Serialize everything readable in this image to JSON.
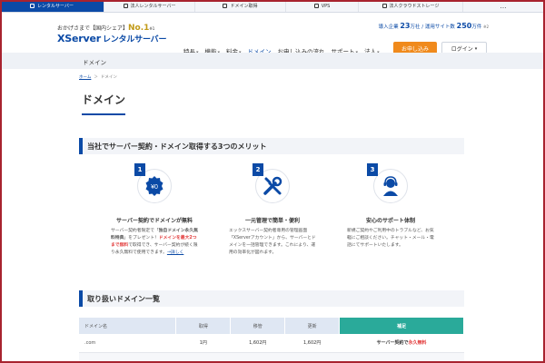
{
  "service_tabs": [
    {
      "label": "レンタルサーバー",
      "active": true
    },
    {
      "label": "法人レンタルサーバー",
      "active": false
    },
    {
      "label": "ドメイン取得",
      "active": false
    },
    {
      "label": "VPS",
      "active": false
    },
    {
      "label": "法人クラウドストレージ",
      "active": false
    },
    {
      "label": "…",
      "active": false
    }
  ],
  "header": {
    "tagline_pre": "おかげさまで【国内シェア】",
    "tagline_no1": "No.1",
    "tagline_note": "※1",
    "logo_main": "XServer",
    "logo_suffix": "レンタルサーバー",
    "stats_companies_label": "導入企業",
    "stats_companies_value": "23",
    "stats_companies_unit": "万社",
    "stats_sites_label": "/ 運用サイト数",
    "stats_sites_value": "250",
    "stats_sites_unit": "万件",
    "stats_note": "※2",
    "nav": [
      {
        "label": "特長",
        "chevron": true
      },
      {
        "label": "機能",
        "chevron": true
      },
      {
        "label": "料金",
        "chevron": true
      },
      {
        "label": "ドメイン",
        "chevron": false,
        "current": true
      },
      {
        "label": "お申し込みの流れ",
        "chevron": false
      },
      {
        "label": "サポート",
        "chevron": true
      },
      {
        "label": "法人",
        "chevron": true
      }
    ],
    "cta_label": "お申し込み",
    "login_label": "ログイン"
  },
  "category_label": "ドメイン",
  "breadcrumb": {
    "home": "ホーム",
    "sep": "＞",
    "current": "ドメイン"
  },
  "page_title": "ドメイン",
  "section1_title": "当社でサーバー契約・ドメイン取得する3つのメリット",
  "merits": [
    {
      "number": "1",
      "icon": "free-badge-icon",
      "title": "サーバー契約でドメインが無料",
      "desc_a": "サーバー契約者限定で「",
      "desc_b": "独自ドメイン永久無料特典",
      "desc_c": "」をプレゼント！",
      "desc_d": "ドメインを最大2つまで無料",
      "desc_e": "で取得でき、サーバー契約が続く限り永久無料で使用できます。",
      "link": "→詳しく"
    },
    {
      "number": "2",
      "icon": "tools-icon",
      "title": "一元管理で簡単・便利",
      "desc": "エックスサーバー契約者専用の管理画面「XServerアカウント」から、サーバーとドメインを一括管理できます。これにより、運用の効率化が図れます。"
    },
    {
      "number": "3",
      "icon": "support-operator-icon",
      "title": "安心のサポート体制",
      "desc": "新規ご契約やご利用中のトラブルなど、お気軽にご相談ください。チャット・メール・電話にてサポートいたします。"
    }
  ],
  "section2_title": "取り扱いドメイン一覧",
  "table": {
    "headers": [
      "ドメイン名",
      "取得",
      "移管",
      "更新",
      "補足"
    ],
    "rows": [
      {
        "domain": ".com",
        "acquire": "1円",
        "transfer": "1,602円",
        "renew": "1,602円",
        "note_a": "サーバー契約で",
        "note_b": "永久無料"
      }
    ]
  },
  "colors": {
    "brand": "#0b4aa6",
    "accent": "#f08a1c",
    "teal": "#2aaa9a",
    "highlight": "#e23b3b"
  }
}
